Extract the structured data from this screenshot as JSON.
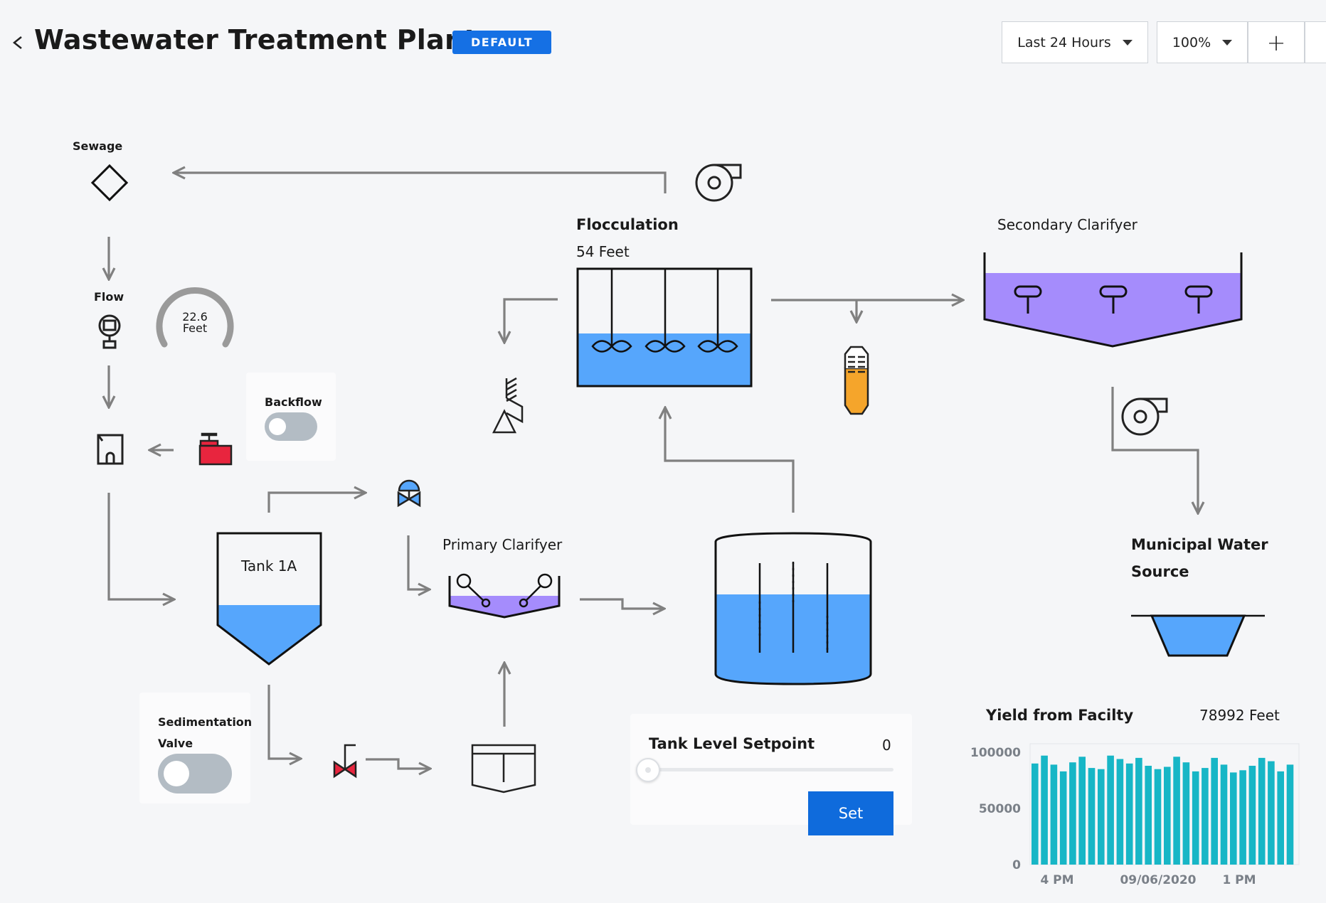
{
  "header": {
    "title": "Wastewater Treatment Plant",
    "badge": "DEFAULT",
    "time_range": "Last 24 Hours",
    "zoom": "100%",
    "zoom_in_label": "+"
  },
  "labels": {
    "sewage": "Sewage",
    "flow": "Flow",
    "flocculation": "Flocculation",
    "flocculation_level": "54 Feet",
    "secondary_clarifyer": "Secondary Clarifyer",
    "primary_clarifyer": "Primary Clarifyer",
    "tank_1a": "Tank 1A",
    "municipal_water_line1": "Municipal Water",
    "municipal_water_line2": "Source"
  },
  "gauge": {
    "value": "22.6",
    "unit": "Feet"
  },
  "backflow": {
    "label": "Backflow",
    "on": false
  },
  "sedimentation_valve": {
    "label_line1": "Sedimentation",
    "label_line2": "Valve",
    "on": false
  },
  "setpoint": {
    "label": "Tank Level Setpoint",
    "value": "0",
    "button": "Set"
  },
  "colors": {
    "water": "#56a6fc",
    "purple": "#a58cfc",
    "pipe": "#808080",
    "valve_red": "#e8253e",
    "orange": "#f5a52b",
    "bar": "#17b6c6",
    "accent": "#1570e4"
  },
  "icons": [
    "back-chevron-icon",
    "sewage-diamond-icon",
    "pump-icon",
    "flow-meter-icon",
    "building-icon",
    "valve-icon",
    "mixer-icon",
    "chemical-tank-icon",
    "filter-icon"
  ],
  "chart_data": {
    "type": "bar",
    "title": "Yield from Facilty",
    "summary": "78992 Feet",
    "ylim": [
      0,
      100000
    ],
    "yticks": [
      "100000",
      "50000",
      "0"
    ],
    "xticks": [
      "4 PM",
      "09/06/2020",
      "1 PM"
    ],
    "values": [
      90000,
      97000,
      89000,
      83000,
      91000,
      96000,
      86000,
      85000,
      97000,
      94000,
      90000,
      95000,
      88000,
      85000,
      87000,
      96000,
      91000,
      83000,
      86000,
      95000,
      89000,
      82000,
      84000,
      88000,
      95000,
      92000,
      83000,
      89000
    ]
  }
}
